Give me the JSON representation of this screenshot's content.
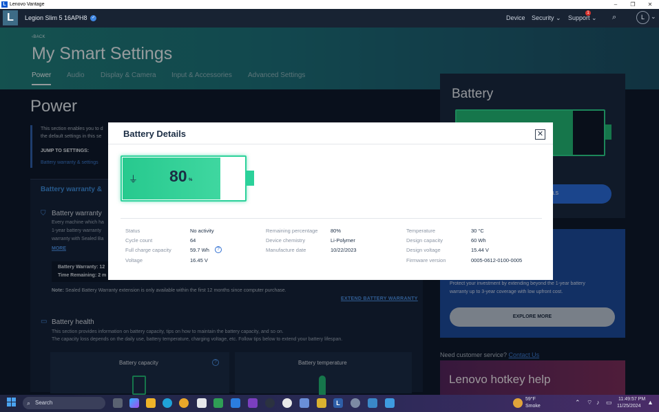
{
  "window": {
    "title": "Lenovo Vantage",
    "logo_letter": "L",
    "minimize": "–",
    "maximize": "❐",
    "close": "✕"
  },
  "appbar": {
    "logo_letter": "L",
    "device_name": "Legion Slim 5 16APH8",
    "nav": {
      "device": "Device",
      "security": "Security",
      "support": "Support"
    },
    "support_badge": "1",
    "avatar_letter": "L"
  },
  "hero": {
    "back": "BACK",
    "title": "My Smart Settings",
    "tabs": [
      "Power",
      "Audio",
      "Display & Camera",
      "Input & Accessories",
      "Advanced Settings"
    ]
  },
  "power": {
    "title": "Power",
    "intro_line1": "This section enables you to d",
    "intro_line2": "the default settings in this se",
    "jump_title": "JUMP TO SETTINGS:",
    "jump_link": "Battery warranty & settings"
  },
  "warranty": {
    "heading": "Battery warranty &",
    "bw_title": "Battery warranty",
    "lines": [
      "Every machine which ha",
      "1-year battery warranty",
      "warranty with Sealed Ba"
    ],
    "more": "MORE",
    "bw_warranty_label": "Battery Warranty: 12",
    "time_remaining_label": "Time Remaining: 2 m",
    "note_bold": "Note:",
    "note_text": " Sealed Battery Warranty extension is only available within the first 12 months since computer purchase.",
    "extend": "EXTEND BATTERY WARRANTY"
  },
  "health": {
    "title": "Battery health",
    "line1": "This section provides information on battery capacity, tips on how to maintain the battery capacity, and so on.",
    "line2": "The capacity loss depends on the daily use, battery temperature, charging voltage, etc. Follow tips below to extend your battery lifespan.",
    "capacity_card": "Battery capacity",
    "temperature_card": "Battery temperature"
  },
  "right": {
    "battery_title": "Battery",
    "details_button": "LS",
    "promo_line1": "Protect your investment by extending beyond the 1-year battery",
    "promo_line2": "warranty up to 3-year coverage with low upfront cost.",
    "explore": "EXPLORE MORE",
    "need_service": "Need customer service? ",
    "contact": "Contact Us",
    "hotkey": "Lenovo hotkey help"
  },
  "modal": {
    "title": "Battery Details",
    "close": "✕",
    "percent": "80",
    "percent_sign": "%",
    "charge_level": 0.8,
    "details": {
      "status": {
        "label": "Status",
        "value": "No activity"
      },
      "cycle": {
        "label": "Cycle count",
        "value": "64"
      },
      "full_charge": {
        "label": "Full charge capacity",
        "value": "59.7 Wh"
      },
      "voltage": {
        "label": "Voltage",
        "value": "16.45 V"
      },
      "remaining": {
        "label": "Remaining percentage",
        "value": "80%"
      },
      "chemistry": {
        "label": "Device chemistry",
        "value": "Li-Polymer"
      },
      "manufacture": {
        "label": "Manufacture date",
        "value": "10/22/2023"
      },
      "temperature": {
        "label": "Temperature",
        "value": "30 °C"
      },
      "design_capacity": {
        "label": "Design capacity",
        "value": "60 Wh"
      },
      "design_voltage": {
        "label": "Design voltage",
        "value": "15.44 V"
      },
      "firmware": {
        "label": "Firmware version",
        "value": "0005-0612-0100-0005"
      }
    }
  },
  "taskbar": {
    "search": "Search",
    "weather_temp": "59°F",
    "weather_desc": "Smoke",
    "time": "11:49:57 PM",
    "date": "11/25/2024"
  },
  "colors": {
    "accent_green": "#2bd19a",
    "link_blue": "#3d7bd1",
    "app_bg": "#0f1a2b",
    "hero_teal": "#1f7d7a"
  }
}
